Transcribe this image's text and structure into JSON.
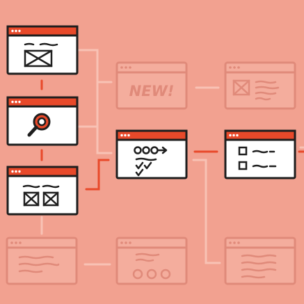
{
  "diagram": {
    "colors": {
      "background": "#f2a190",
      "ink": "#1e1e1e",
      "accent": "#e8492a",
      "window_fill": "#ffffff",
      "faded_stroke": "#e08a7a",
      "faded_fill": "#f4ad9d"
    },
    "nodes": [
      {
        "id": "layout-wireframe",
        "icon": "image-placeholder-icon",
        "state": "active"
      },
      {
        "id": "search-page",
        "icon": "magnifier-icon",
        "state": "active"
      },
      {
        "id": "gallery-wireframe",
        "icon": "image-grid-icon",
        "state": "active"
      },
      {
        "id": "checklist-form",
        "icon": "checklist-icon",
        "state": "active"
      },
      {
        "id": "list-view",
        "icon": "checkbox-list-icon",
        "state": "active"
      },
      {
        "id": "new-announcement",
        "icon": "new-badge-icon",
        "state": "faded",
        "text": "NEW!"
      },
      {
        "id": "article-with-image",
        "icon": "image-text-icon",
        "state": "faded"
      },
      {
        "id": "text-page",
        "icon": "text-lines-icon",
        "state": "faded"
      },
      {
        "id": "dots-page",
        "icon": "dots-icon",
        "state": "faded"
      },
      {
        "id": "text-document",
        "icon": "text-lines-icon",
        "state": "faded"
      }
    ]
  }
}
